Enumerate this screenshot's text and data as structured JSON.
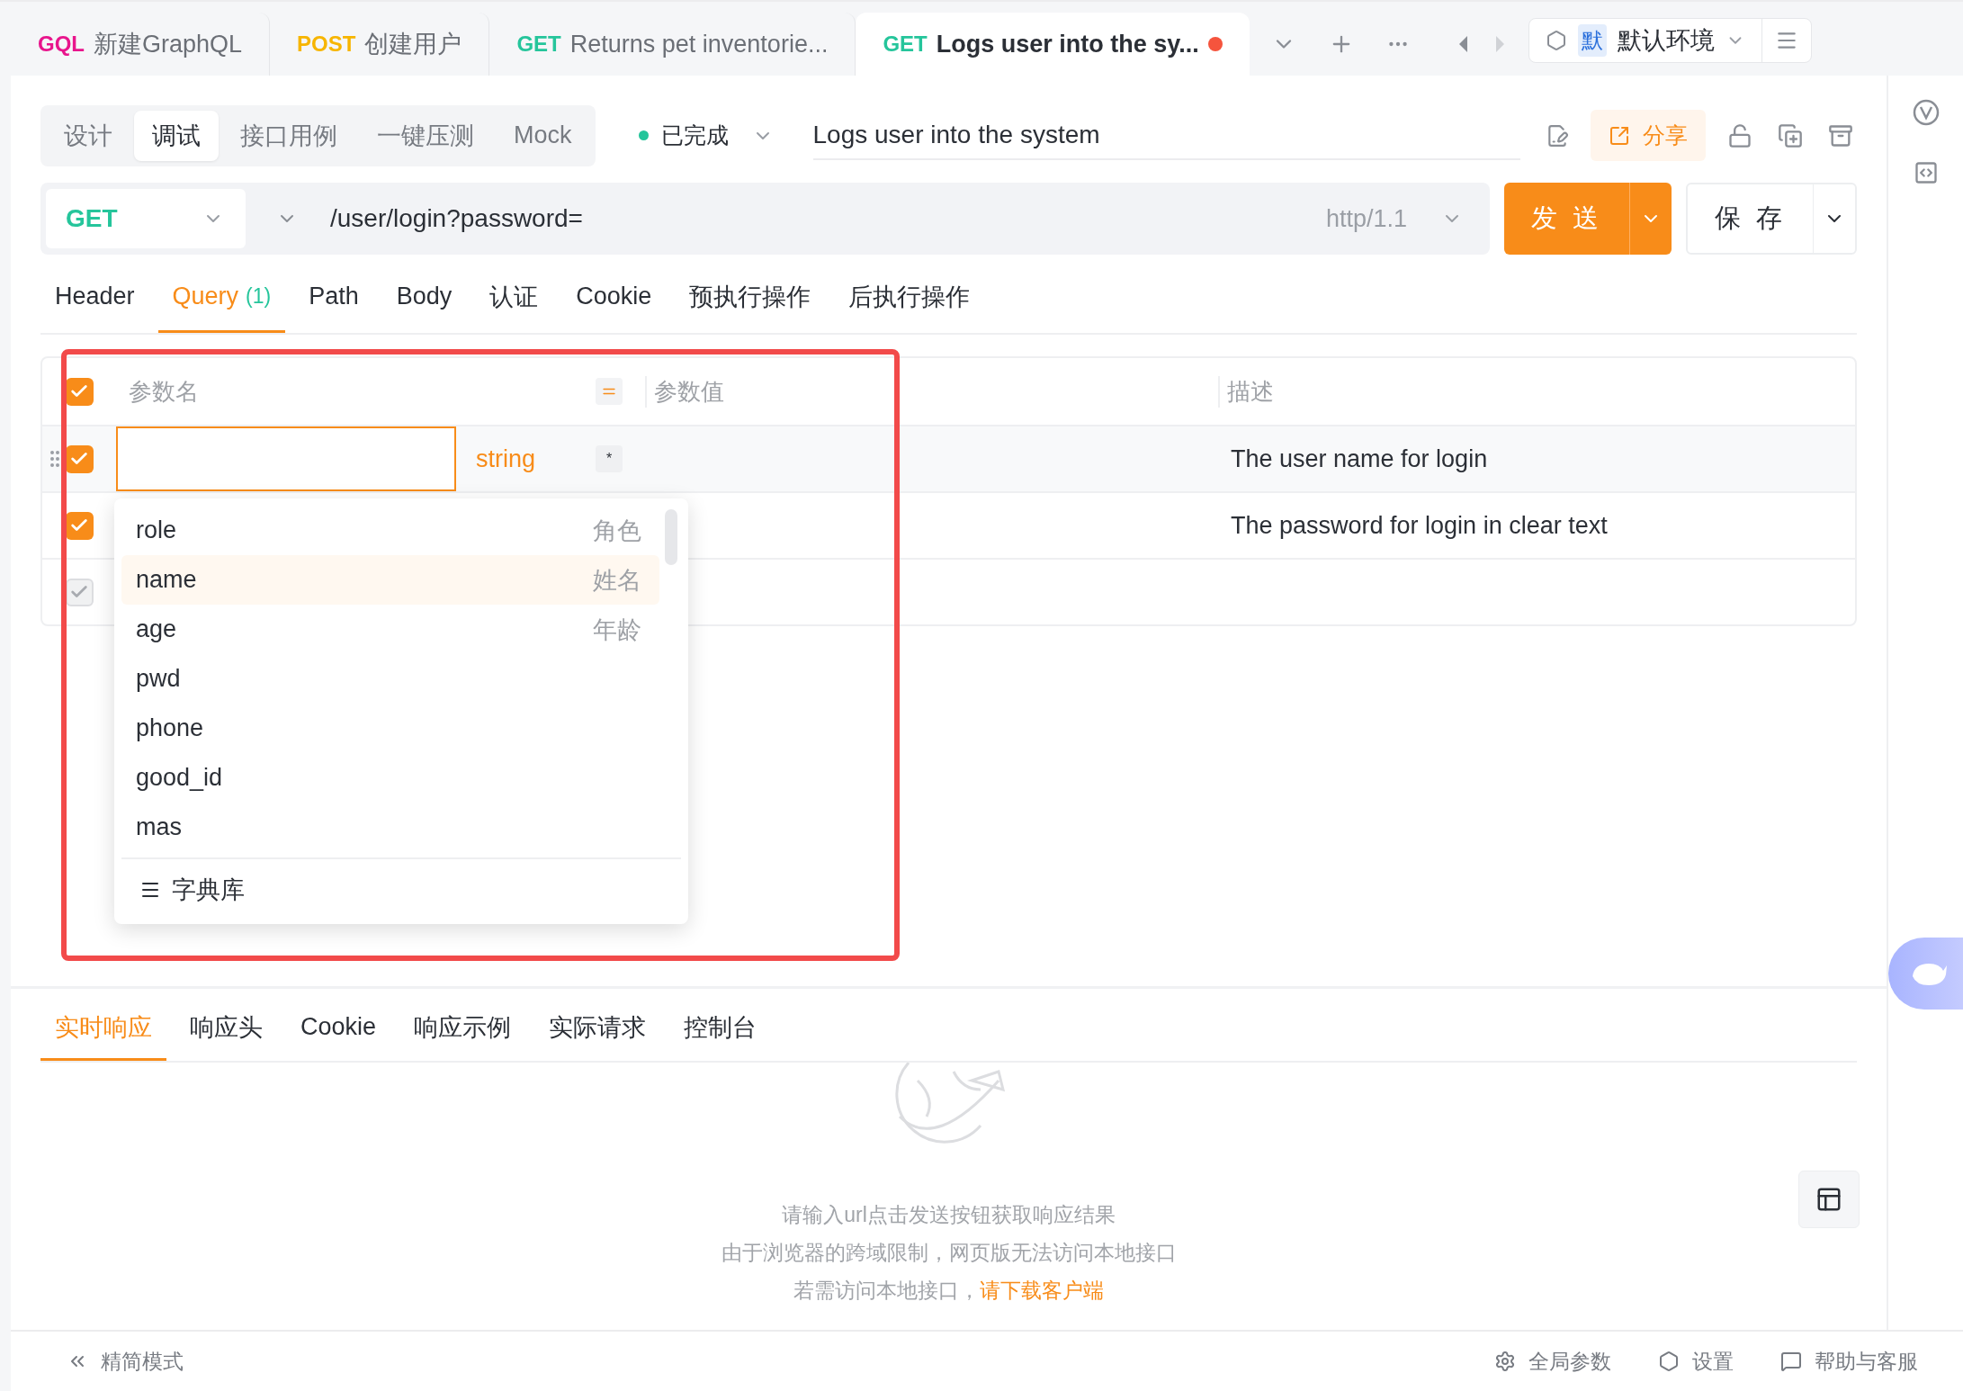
{
  "request_tabs": [
    {
      "method": "GQL",
      "color": "#e8158c",
      "title": "新建GraphQL",
      "selected": false,
      "modified": false
    },
    {
      "method": "POST",
      "color": "#f7b500",
      "title": "创建用户",
      "selected": false,
      "modified": false
    },
    {
      "method": "GET",
      "color": "#25c59b",
      "title": "Returns pet inventorie...",
      "selected": false,
      "modified": false
    },
    {
      "method": "GET",
      "color": "#25c59b",
      "title": "Logs user into the sy...",
      "selected": true,
      "modified": true
    }
  ],
  "environment": {
    "badge": "默",
    "name": "默认环境"
  },
  "mode_tabs": [
    {
      "label": "设计",
      "selected": false
    },
    {
      "label": "调试",
      "selected": true
    },
    {
      "label": "接口用例",
      "selected": false
    },
    {
      "label": "一键压测",
      "selected": false
    },
    {
      "label": "Mock",
      "selected": false
    }
  ],
  "status": {
    "label": "已完成",
    "color": "#25c59b"
  },
  "title": "Logs user into the system",
  "share_button": "分享",
  "request": {
    "method": "GET",
    "url": "/user/login?password=",
    "protocol": "http/1.1",
    "send_button": "发 送",
    "save_button": "保 存"
  },
  "param_tabs": [
    {
      "label": "Header",
      "selected": false
    },
    {
      "label": "Query",
      "count": "(1)",
      "selected": true
    },
    {
      "label": "Path",
      "selected": false
    },
    {
      "label": "Body",
      "selected": false
    },
    {
      "label": "认证",
      "selected": false
    },
    {
      "label": "Cookie",
      "selected": false
    },
    {
      "label": "预执行操作",
      "selected": false
    },
    {
      "label": "后执行操作",
      "selected": false
    }
  ],
  "params_table": {
    "all_checked": true,
    "columns": [
      "参数名",
      "参数值",
      "描述"
    ],
    "rows": [
      {
        "checked": true,
        "disabled": false,
        "editing": true,
        "name": "",
        "type": "string",
        "required": "*",
        "description": "The user name for login"
      },
      {
        "checked": true,
        "disabled": false,
        "editing": false,
        "description": "The password for login in clear text"
      },
      {
        "checked": true,
        "disabled": true,
        "editing": false
      }
    ]
  },
  "suggestions": {
    "items": [
      {
        "name": "role",
        "label": "角色",
        "selected": false
      },
      {
        "name": "name",
        "label": "姓名",
        "selected": true
      },
      {
        "name": "age",
        "label": "年龄",
        "selected": false
      },
      {
        "name": "pwd",
        "selected": false
      },
      {
        "name": "phone",
        "selected": false
      },
      {
        "name": "good_id",
        "selected": false
      },
      {
        "name": "mas",
        "selected": false
      }
    ],
    "footer": "字典库"
  },
  "response_tabs": [
    {
      "label": "实时响应",
      "selected": true
    },
    {
      "label": "响应头",
      "selected": false
    },
    {
      "label": "Cookie",
      "selected": false
    },
    {
      "label": "响应示例",
      "selected": false
    },
    {
      "label": "实际请求",
      "selected": false
    },
    {
      "label": "控制台",
      "selected": false
    }
  ],
  "empty_state": {
    "lines": [
      "请输入url点击发送按钮获取响应结果",
      "由于浏览器的跨域限制，网页版无法访问本地接口"
    ],
    "hint": "若需访问本地接口，",
    "link": "请下载客户端"
  },
  "footer": {
    "mode": "精简模式",
    "items": [
      {
        "kind": "params",
        "label": "全局参数"
      },
      {
        "kind": "settings",
        "label": "设置"
      },
      {
        "kind": "help",
        "label": "帮助与客服"
      }
    ]
  }
}
